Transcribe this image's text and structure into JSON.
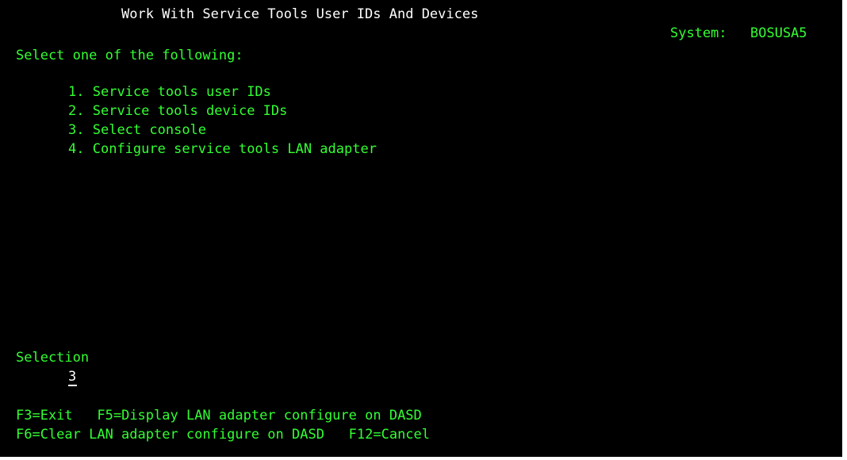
{
  "screen": {
    "title": "Work With Service Tools User IDs And Devices",
    "system_label": "System:",
    "system_name": "BOSUSA5"
  },
  "prompt": "Select one of the following:",
  "options": [
    {
      "num": "1.",
      "label": "Service tools user IDs"
    },
    {
      "num": "2.",
      "label": "Service tools device IDs"
    },
    {
      "num": "3.",
      "label": "Select console"
    },
    {
      "num": "4.",
      "label": "Configure service tools LAN adapter"
    }
  ],
  "selection": {
    "label": "Selection",
    "value": "3"
  },
  "function_keys": {
    "f3": "F3=Exit",
    "f5": "F5=Display LAN adapter configure on DASD",
    "f6": "F6=Clear LAN adapter configure on DASD",
    "f12": "F12=Cancel"
  },
  "colors": {
    "background": "#000000",
    "text_primary": "#33ff33",
    "text_highlight": "#ffffff"
  }
}
